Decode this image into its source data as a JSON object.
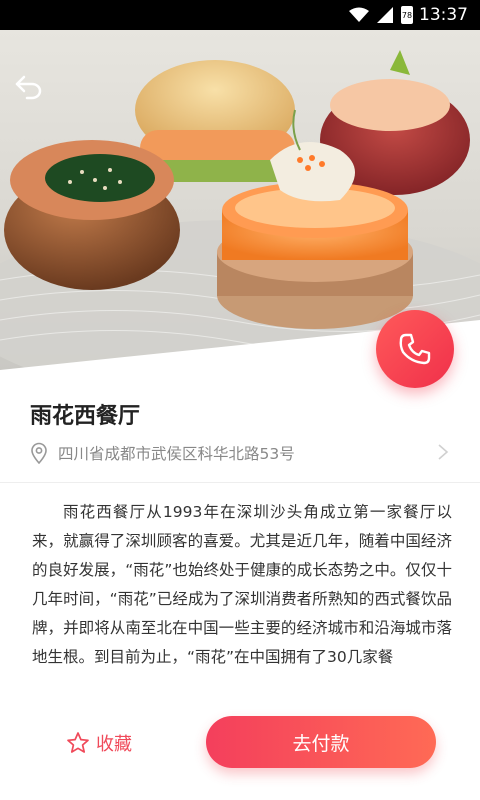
{
  "status_bar": {
    "time": "13:37",
    "battery_text": "78",
    "icons": [
      "wifi-icon",
      "cell-signal-icon",
      "battery-icon"
    ]
  },
  "hero": {
    "image": "restaurant-dish-photo",
    "back_icon": "back-arrow-icon",
    "phone_icon": "phone-icon"
  },
  "restaurant": {
    "name": "雨花西餐厅",
    "address": "四川省成都市武侯区科华北路53号",
    "description": "雨花西餐厅从1993年在深圳沙头角成立第一家餐厅以来，就赢得了深圳顾客的喜爱。尤其是近几年，随着中国经济的良好发展，“雨花”也始终处于健康的成长态势之中。仅仅十几年时间，“雨花”已经成为了深圳消费者所熟知的西式餐饮品牌，并即将从南至北在中国一些主要的经济城市和沿海城市落地生根。到目前为止，“雨花”在中国拥有了30几家餐"
  },
  "actions": {
    "favorite_label": "收藏",
    "pay_label": "去付款"
  },
  "colors": {
    "accent": "#f04a5a",
    "text": "#333333",
    "muted": "#888888"
  }
}
